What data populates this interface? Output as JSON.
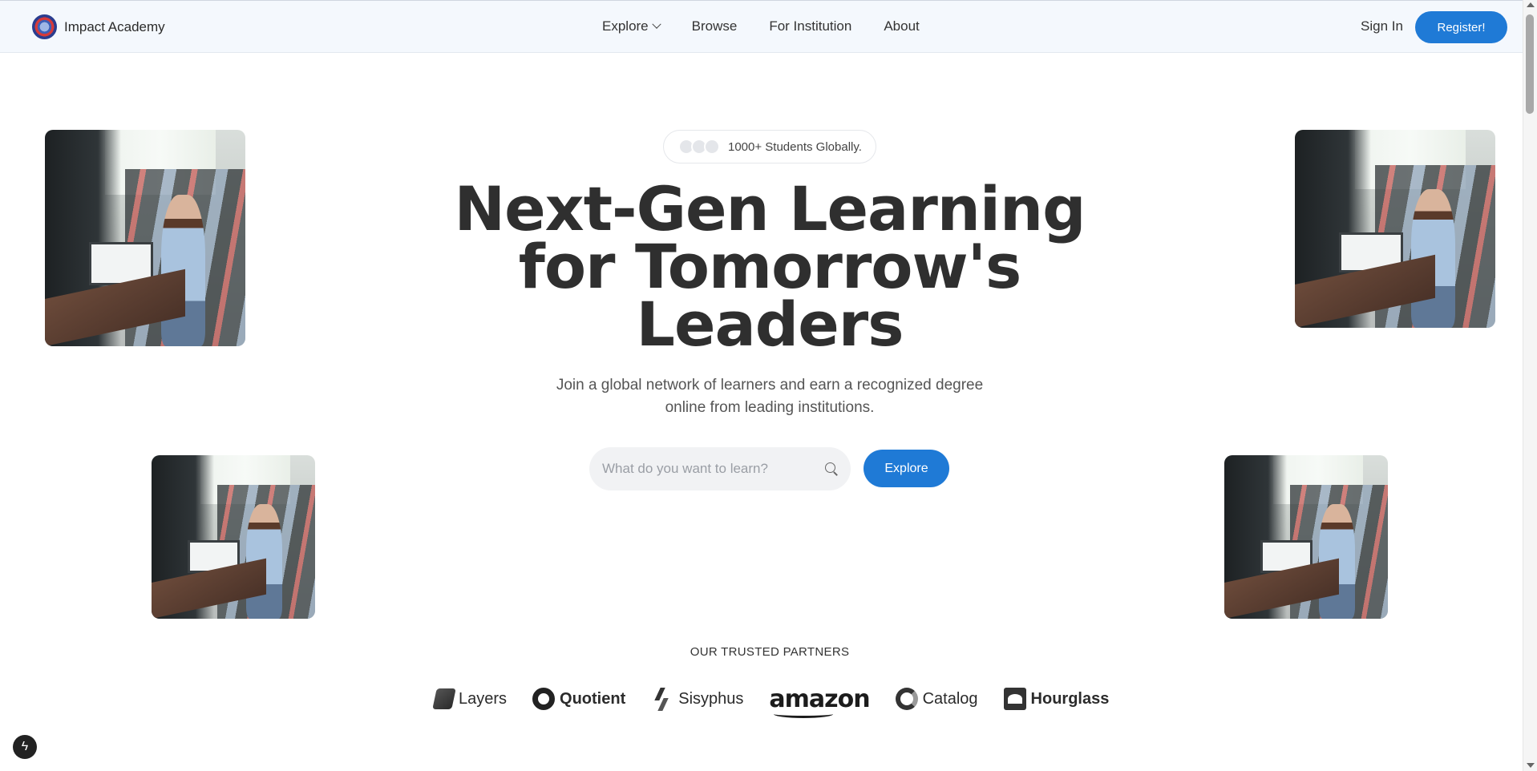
{
  "brand": {
    "name": "Impact Academy"
  },
  "nav": {
    "items": [
      {
        "label": "Explore",
        "has_dropdown": true
      },
      {
        "label": "Browse"
      },
      {
        "label": "For Institution"
      },
      {
        "label": "About"
      }
    ],
    "sign_in": "Sign In",
    "register": "Register!"
  },
  "hero": {
    "badge_text": "1000+ Students Globally.",
    "headline_lines": [
      "Next-Gen Learning",
      "for Tomorrow's",
      "Leaders"
    ],
    "subtext_lines": [
      "Join a global network of learners and earn a recognized degree",
      "online from leading institutions."
    ],
    "search": {
      "placeholder": "What do you want to learn?",
      "value": ""
    },
    "explore_button": "Explore"
  },
  "partners": {
    "title": "OUR TRUSTED PARTNERS",
    "items": [
      {
        "name": "Layers",
        "icon": "layers-icon"
      },
      {
        "name": "Quotient",
        "icon": "quotient-icon"
      },
      {
        "name": "Sisyphus",
        "icon": "sisyphus-icon"
      },
      {
        "name": "amazon",
        "icon": "amazon-logo"
      },
      {
        "name": "Catalog",
        "icon": "catalog-icon"
      },
      {
        "name": "Hourglass",
        "icon": "hourglass-icon"
      }
    ]
  },
  "colors": {
    "accent": "#1f7ad6",
    "nav_bg": "#f4f8fd",
    "text": "#2f2f2f"
  }
}
